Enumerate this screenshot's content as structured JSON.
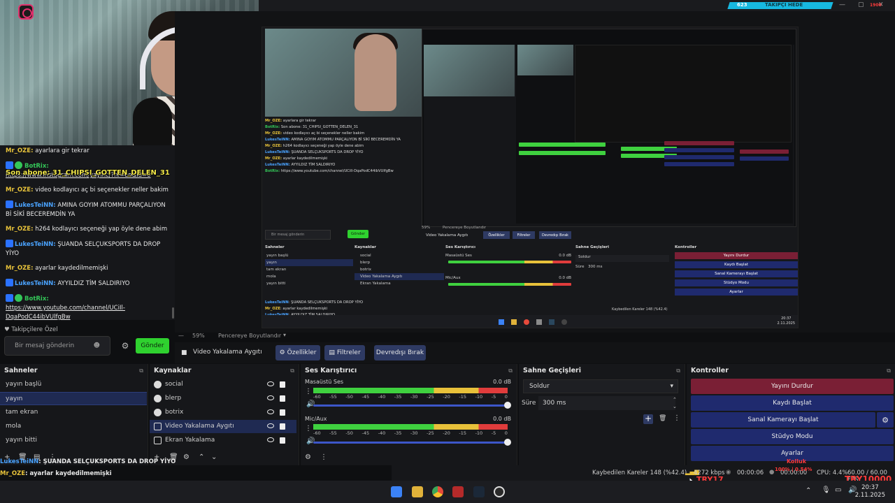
{
  "chat": {
    "messages": [
      {
        "user": "Mr_OZE:",
        "user_color": "yellow",
        "text": "ayarlara gir tekrar"
      },
      {
        "user": "BotRix:",
        "user_color": "green",
        "text": "https://www.instagram.com/yaylnc/?hl=en&id=0",
        "link": true
      },
      {
        "user": "Mr_OZE:",
        "user_color": "yellow",
        "text": "video kodlayıcı aç bi seçenekler neller bakim"
      },
      {
        "user": "LukesTeiNN:",
        "user_color": "blue",
        "text": "AMINA GOYIM ATOMMU PARÇALIYON Bİ SİKİ BECEREMDİN YA"
      },
      {
        "user": "Mr_OZE:",
        "user_color": "yellow",
        "text": "h264 kodlayıcı seçeneği yap öyle dene abim"
      },
      {
        "user": "LukesTeiNN:",
        "user_color": "blue",
        "text": "ŞUANDA SELÇUKSPORTS DA DROP YİYO"
      },
      {
        "user": "Mr_OZE:",
        "user_color": "yellow",
        "text": "ayarlar kaydedilmemişki"
      },
      {
        "user": "LukesTeiNN:",
        "user_color": "blue",
        "text": "AYYILDIZ TİM SALDIRIYO"
      },
      {
        "user": "BotRix:",
        "user_color": "green",
        "text": "https://www.youtube.com/channel/UCiIl-DqaPodC44ibVUlfgBw",
        "link": true
      }
    ],
    "alert_overlay": "Son abone: 31_CHIPSI_GOTTEN_DELEN_31",
    "follow_label": "Takipçilere Özel",
    "input_placeholder": "Bir mesaj gönderin",
    "send_label": "Gönder"
  },
  "topbar": {
    "followers_count": "623",
    "followers_label": "TAKIPÇI HEDE",
    "goal_text": "1900"
  },
  "nested": {
    "chat": [
      {
        "user": "Mr_OZE:",
        "text": "ayarlara gir tekrar"
      },
      {
        "user": "BotRix:",
        "text": "Son abone: 31_CHIPSI_GOTTEN_DELEN_31"
      },
      {
        "user": "Mr_OZE:",
        "text": "video kodlayıcı aç bi seçenekler neller bakim"
      },
      {
        "user": "LukesTeiNN:",
        "text": "AMINA GOYIM ATOMMU PARÇALIYON Bİ SİKİ BECEREMDİN YA"
      },
      {
        "user": "Mr_OZE:",
        "text": "h264 kodlayıcı seçeneği yap öyle dene abim"
      },
      {
        "user": "LukesTeiNN:",
        "text": "ŞUANDA SELÇUKSPORTS DA DROP YİYO"
      },
      {
        "user": "Mr_OZE:",
        "text": "ayarlar kaydedilmemişki"
      },
      {
        "user": "LukesTeiNN:",
        "text": "AYYILDIZ TİM SALDIRIYO"
      },
      {
        "user": "BotRix:",
        "text": "https://www.youtube.com/channel/UCiIl-DqaPodC44ibVUlfgBw"
      }
    ],
    "follow_label": "Takipçilere Özel",
    "input_placeholder": "Bir mesaj gönderin",
    "send_label": "Gönder",
    "zoom": "59%",
    "preview_size": "Pencereye Boyutlandır",
    "source_name": "Video Yakalama Aygıtı",
    "props": "Özellikler",
    "filters": "Filtreler",
    "deactivate": "Devredışı Bırak",
    "docks": {
      "scenes": "Sahneler",
      "sources": "Kaynaklar",
      "mixer": "Ses Karıştırıcı",
      "transitions": "Sahne Geçişleri",
      "controls": "Kontroller"
    },
    "scenes": [
      "yayın başlü",
      "yayın",
      "tam ekran",
      "mola",
      "yayın bitti"
    ],
    "sources": [
      "social",
      "blerp",
      "botrix",
      "Video Yakalama Aygıtı",
      "Ekran Yakalama"
    ],
    "mixer": [
      {
        "name": "Masaüstü Ses",
        "db": "0.0 dB"
      },
      {
        "name": "Mic/Aux",
        "db": "0.0 dB"
      }
    ],
    "transition": "Soldur",
    "duration_label": "Süre",
    "duration": "300 ms",
    "controls": [
      "Yayını Durdur",
      "Kaydı Başlat",
      "Sanal Kamerayı Başlat",
      "Stüdyo Modu",
      "Ayarlar"
    ],
    "footer": [
      {
        "user": "LukesTeiNN",
        "text": ": ŞUANDA SELÇUKSPORTS DA DROP YİYO"
      },
      {
        "user": "Mr_OZE",
        "text": ": ayarlar kaydedilmemişki"
      },
      {
        "user": "LukesTeiNN",
        "text": ": AYYILDIZ TİM SALDIRIYO"
      },
      {
        "user": "BotRix",
        "text": ": https://www.youtube.com/channel/UCiIl-DqaPodC44ibVUlfgBw"
      }
    ],
    "status": "Kaybedilen Kareler 148 (%42.4)",
    "clock_time": "20:37",
    "clock_date": "2.11.2025"
  },
  "preview_toolbar": {
    "zoom": "59%",
    "fit": "Pencereye Boyutlandır"
  },
  "source_toolbar": {
    "name": "Video Yakalama Aygıtı",
    "props": "Özellikler",
    "filters": "Filtreler",
    "deactivate": "Devredışı Bırak"
  },
  "docks": {
    "scenes": {
      "title": "Sahneler",
      "items": [
        "yayın başlü",
        "yayın",
        "tam ekran",
        "mola",
        "yayın bitti"
      ],
      "selected": 1
    },
    "sources": {
      "title": "Kaynaklar",
      "items": [
        "social",
        "blerp",
        "botrix",
        "Video Yakalama Aygıtı",
        "Ekran Yakalama"
      ],
      "selected": 3
    },
    "mixer": {
      "title": "Ses Karıştırıcı",
      "channels": [
        {
          "name": "Masaüstü Ses",
          "db": "0.0 dB"
        },
        {
          "name": "Mic/Aux",
          "db": "0.0 dB"
        }
      ],
      "ticks": [
        "-60",
        "-55",
        "-50",
        "-45",
        "-40",
        "-35",
        "-30",
        "-25",
        "-20",
        "-15",
        "-10",
        "-5",
        "0"
      ]
    },
    "transitions": {
      "title": "Sahne Geçişleri",
      "selected": "Soldur",
      "duration_label": "Süre",
      "duration": "300 ms"
    },
    "controls": {
      "title": "Kontroller",
      "buttons": [
        {
          "label": "Yayını Durdur",
          "color": "#7a1f35"
        },
        {
          "label": "Kaydı Başlat",
          "color": "#1f2a6e"
        },
        {
          "label": "Sanal Kamerayı Başlat",
          "color": "#1f2a6e"
        },
        {
          "label": "Stüdyo Modu",
          "color": "#1f2a6e"
        },
        {
          "label": "Ayarlar",
          "color": "#1f2a6e"
        }
      ]
    }
  },
  "bottom_chat": [
    {
      "user": "LukesTeiNN",
      "user_color": "blue",
      "text": ": ŞUANDA SELÇUKSPORTS DA DROP YİYO"
    },
    {
      "user": "Mr_OZE",
      "user_color": "yellow",
      "text": ": ayarlar kaydedilmemişki"
    },
    {
      "user": "LukesTeiNN",
      "user_color": "blue",
      "text": ": AYYILDIZ TİM SALDIRIYO"
    },
    {
      "user": "BotRix",
      "user_color": "green",
      "text": ": https://www.youtube.com/channel/UCiIl-DqaPodC44ibVUlfgBw"
    }
  ],
  "status_bar": {
    "dropped": "Kaybedilen Kareler 148 (%42.4)",
    "bitrate": "4272 kbps",
    "stream_time": "00:00:06",
    "rec_time": "00:00:00",
    "cpu": "CPU: 4.4%",
    "fps": "60.00 / 60.00 FPS"
  },
  "overlays": {
    "kolluk": "Kolluk",
    "kolluk_sub": "100% | 0.54%",
    "try_left": "TRY17",
    "try_right": "TRY10000"
  },
  "taskbar": {
    "time": "20:37",
    "date": "2.11.2025"
  }
}
